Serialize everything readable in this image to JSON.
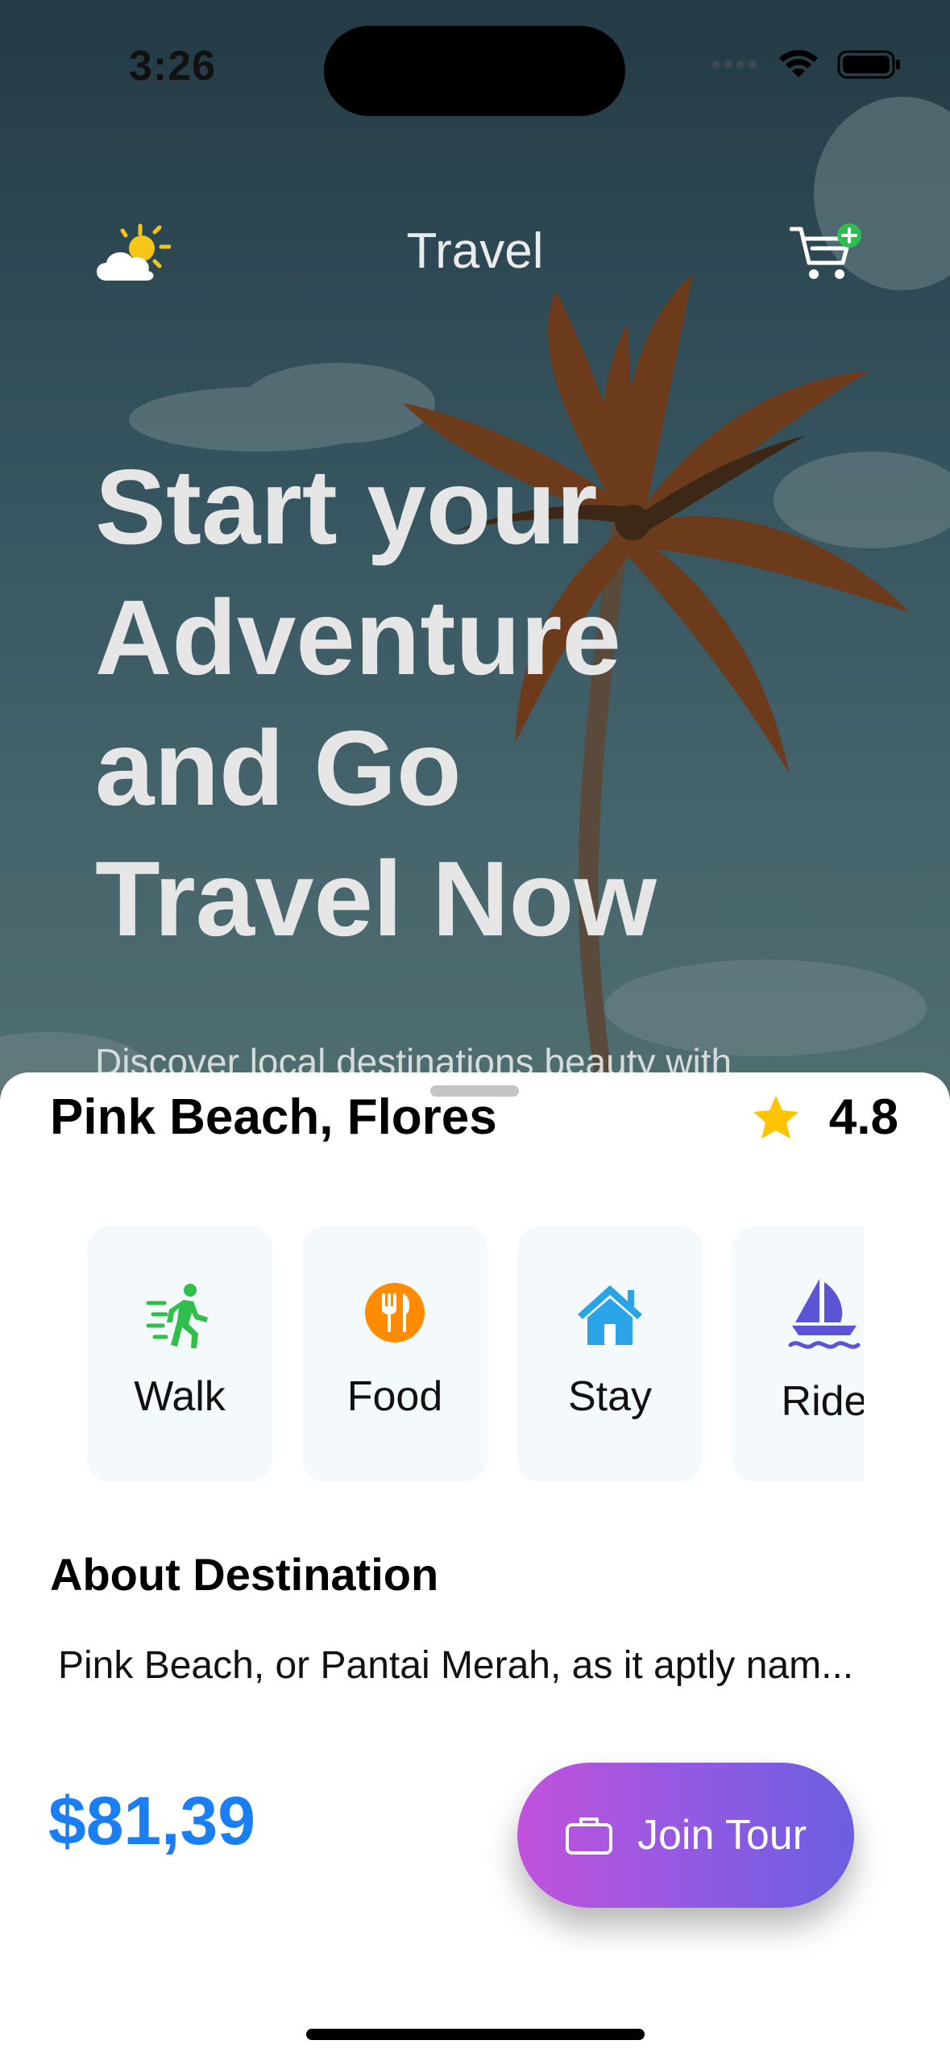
{
  "status_bar": {
    "time": "3:26"
  },
  "nav": {
    "title": "Travel",
    "weather_icon": "cloud-sun-icon",
    "cart_icon": "cart-badge-plus-icon"
  },
  "hero": {
    "headline_lines": [
      "Start your",
      "Adventure",
      "and Go",
      "Travel Now"
    ],
    "subtitle": "Discover local destinations beauty with"
  },
  "destination": {
    "name": "Pink Beach, Flores",
    "rating": "4.8",
    "categories": [
      {
        "label": "Walk",
        "icon": "walk-icon",
        "color": "#2fbf4a"
      },
      {
        "label": "Food",
        "icon": "fork-knife-icon",
        "color": "#ff8c00"
      },
      {
        "label": "Stay",
        "icon": "house-icon",
        "color": "#2aa3e8"
      },
      {
        "label": "Ride",
        "icon": "sailboat-icon",
        "color": "#5b55d6"
      }
    ],
    "about_title": "About Destination",
    "about_text": "Pink Beach, or Pantai Merah, as it aptly nam...",
    "price": "$81,39",
    "cta_label": "Join Tour"
  },
  "colors": {
    "accent_price": "#1a7ef5",
    "star": "#ffc400",
    "cta_gradient_start": "#c152dc",
    "cta_gradient_end": "#6b5ee0"
  }
}
